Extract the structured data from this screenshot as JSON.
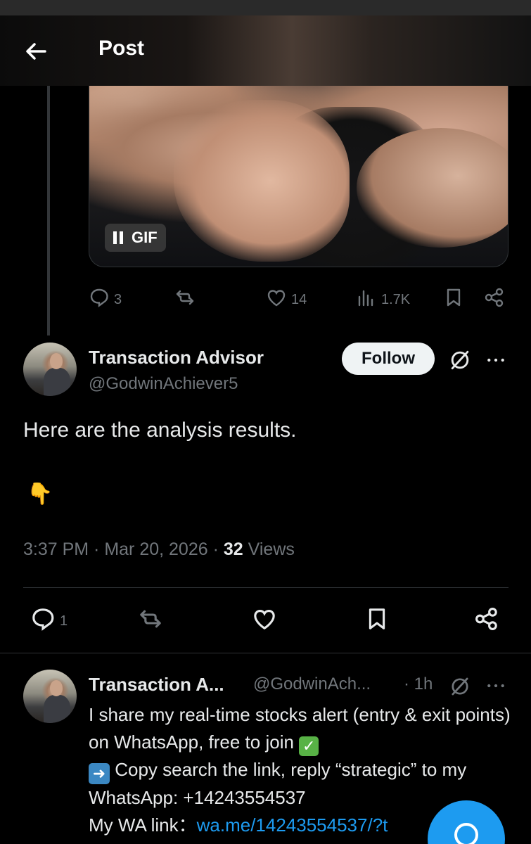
{
  "header": {
    "title": "Post"
  },
  "media": {
    "badge_label": "GIF"
  },
  "parent_actions": {
    "replies": "3",
    "likes": "14",
    "views": "1.7K"
  },
  "tweet": {
    "display_name": "Transaction Advisor",
    "handle": "@GodwinAchiever5",
    "follow_label": "Follow",
    "text": "Here are the analysis results.",
    "emoji": "👇",
    "time": "3:37 PM",
    "date": "Mar 20, 2026",
    "views_count": "32",
    "views_label": "Views",
    "reply_count": "1"
  },
  "reply": {
    "display_name": "Transaction A...",
    "handle": "@GodwinAch...",
    "time": "1h",
    "line1": "I share my real-time stocks alert (entry & exit points) on WhatsApp, free to join",
    "line2": "Copy search the link, reply “strategic” to my WhatsApp: +14243554537",
    "link_prefix": "My WA link：",
    "link": "wa.me/14243554537/?t"
  },
  "colors": {
    "background": "#000000",
    "text": "#e7e9ea",
    "muted": "#71767b",
    "accent": "#1d9bf0",
    "divider": "#2f3336"
  },
  "icons": [
    "back-arrow-icon",
    "pause-icon",
    "reply-icon",
    "repost-icon",
    "like-icon",
    "views-icon",
    "bookmark-icon",
    "share-icon",
    "grok-icon",
    "more-icon",
    "compose-icon"
  ]
}
